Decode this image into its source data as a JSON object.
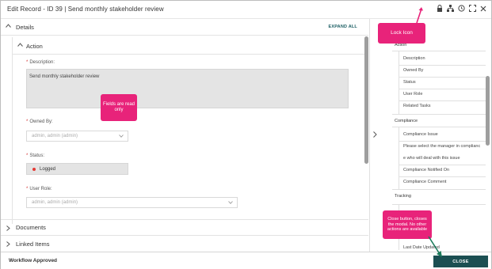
{
  "window": {
    "title": "Edit Record - ID 39 | Send monthly stakeholder review",
    "icons": [
      "lock-icon",
      "hierarchy-icon",
      "history-icon",
      "fullscreen-icon",
      "close-icon"
    ]
  },
  "details": {
    "label": "Details",
    "expand_all": "EXPAND ALL",
    "action": {
      "label": "Action",
      "description_label": "Description:",
      "description_value": "Send monthly stakeholder review",
      "owned_by_label": "Owned By:",
      "owned_by_value": "admin, admin (admin)",
      "status_label": "Status:",
      "status_value": "Logged",
      "status_color": "#e53935",
      "user_role_label": "User Role:",
      "user_role_value": "admin, admin (admin)"
    }
  },
  "sections": {
    "documents": "Documents",
    "linked_items": "Linked Items"
  },
  "nav": {
    "action_group": "Action",
    "action_items": [
      "Description",
      "Owned By",
      "Status",
      "User Role",
      "Related Tasks"
    ],
    "compliance_group": "Compliance",
    "compliance_items": [
      "Compliance Issue",
      "Please select the manager in complianc",
      "e who will deal with this issue",
      "Compliance Notified On",
      "Compliance Comment"
    ],
    "tracking_group": "Tracking",
    "tracking_items": [
      "Last Date Updated"
    ]
  },
  "footer": {
    "status": "Workflow Approved",
    "close_label": "CLOSE"
  },
  "annotations": {
    "lock_icon": "Lock Icon",
    "fields": "Fields are read only",
    "close": "Close button, closes the modal. No other actions are available",
    "color": "#e8237a"
  }
}
